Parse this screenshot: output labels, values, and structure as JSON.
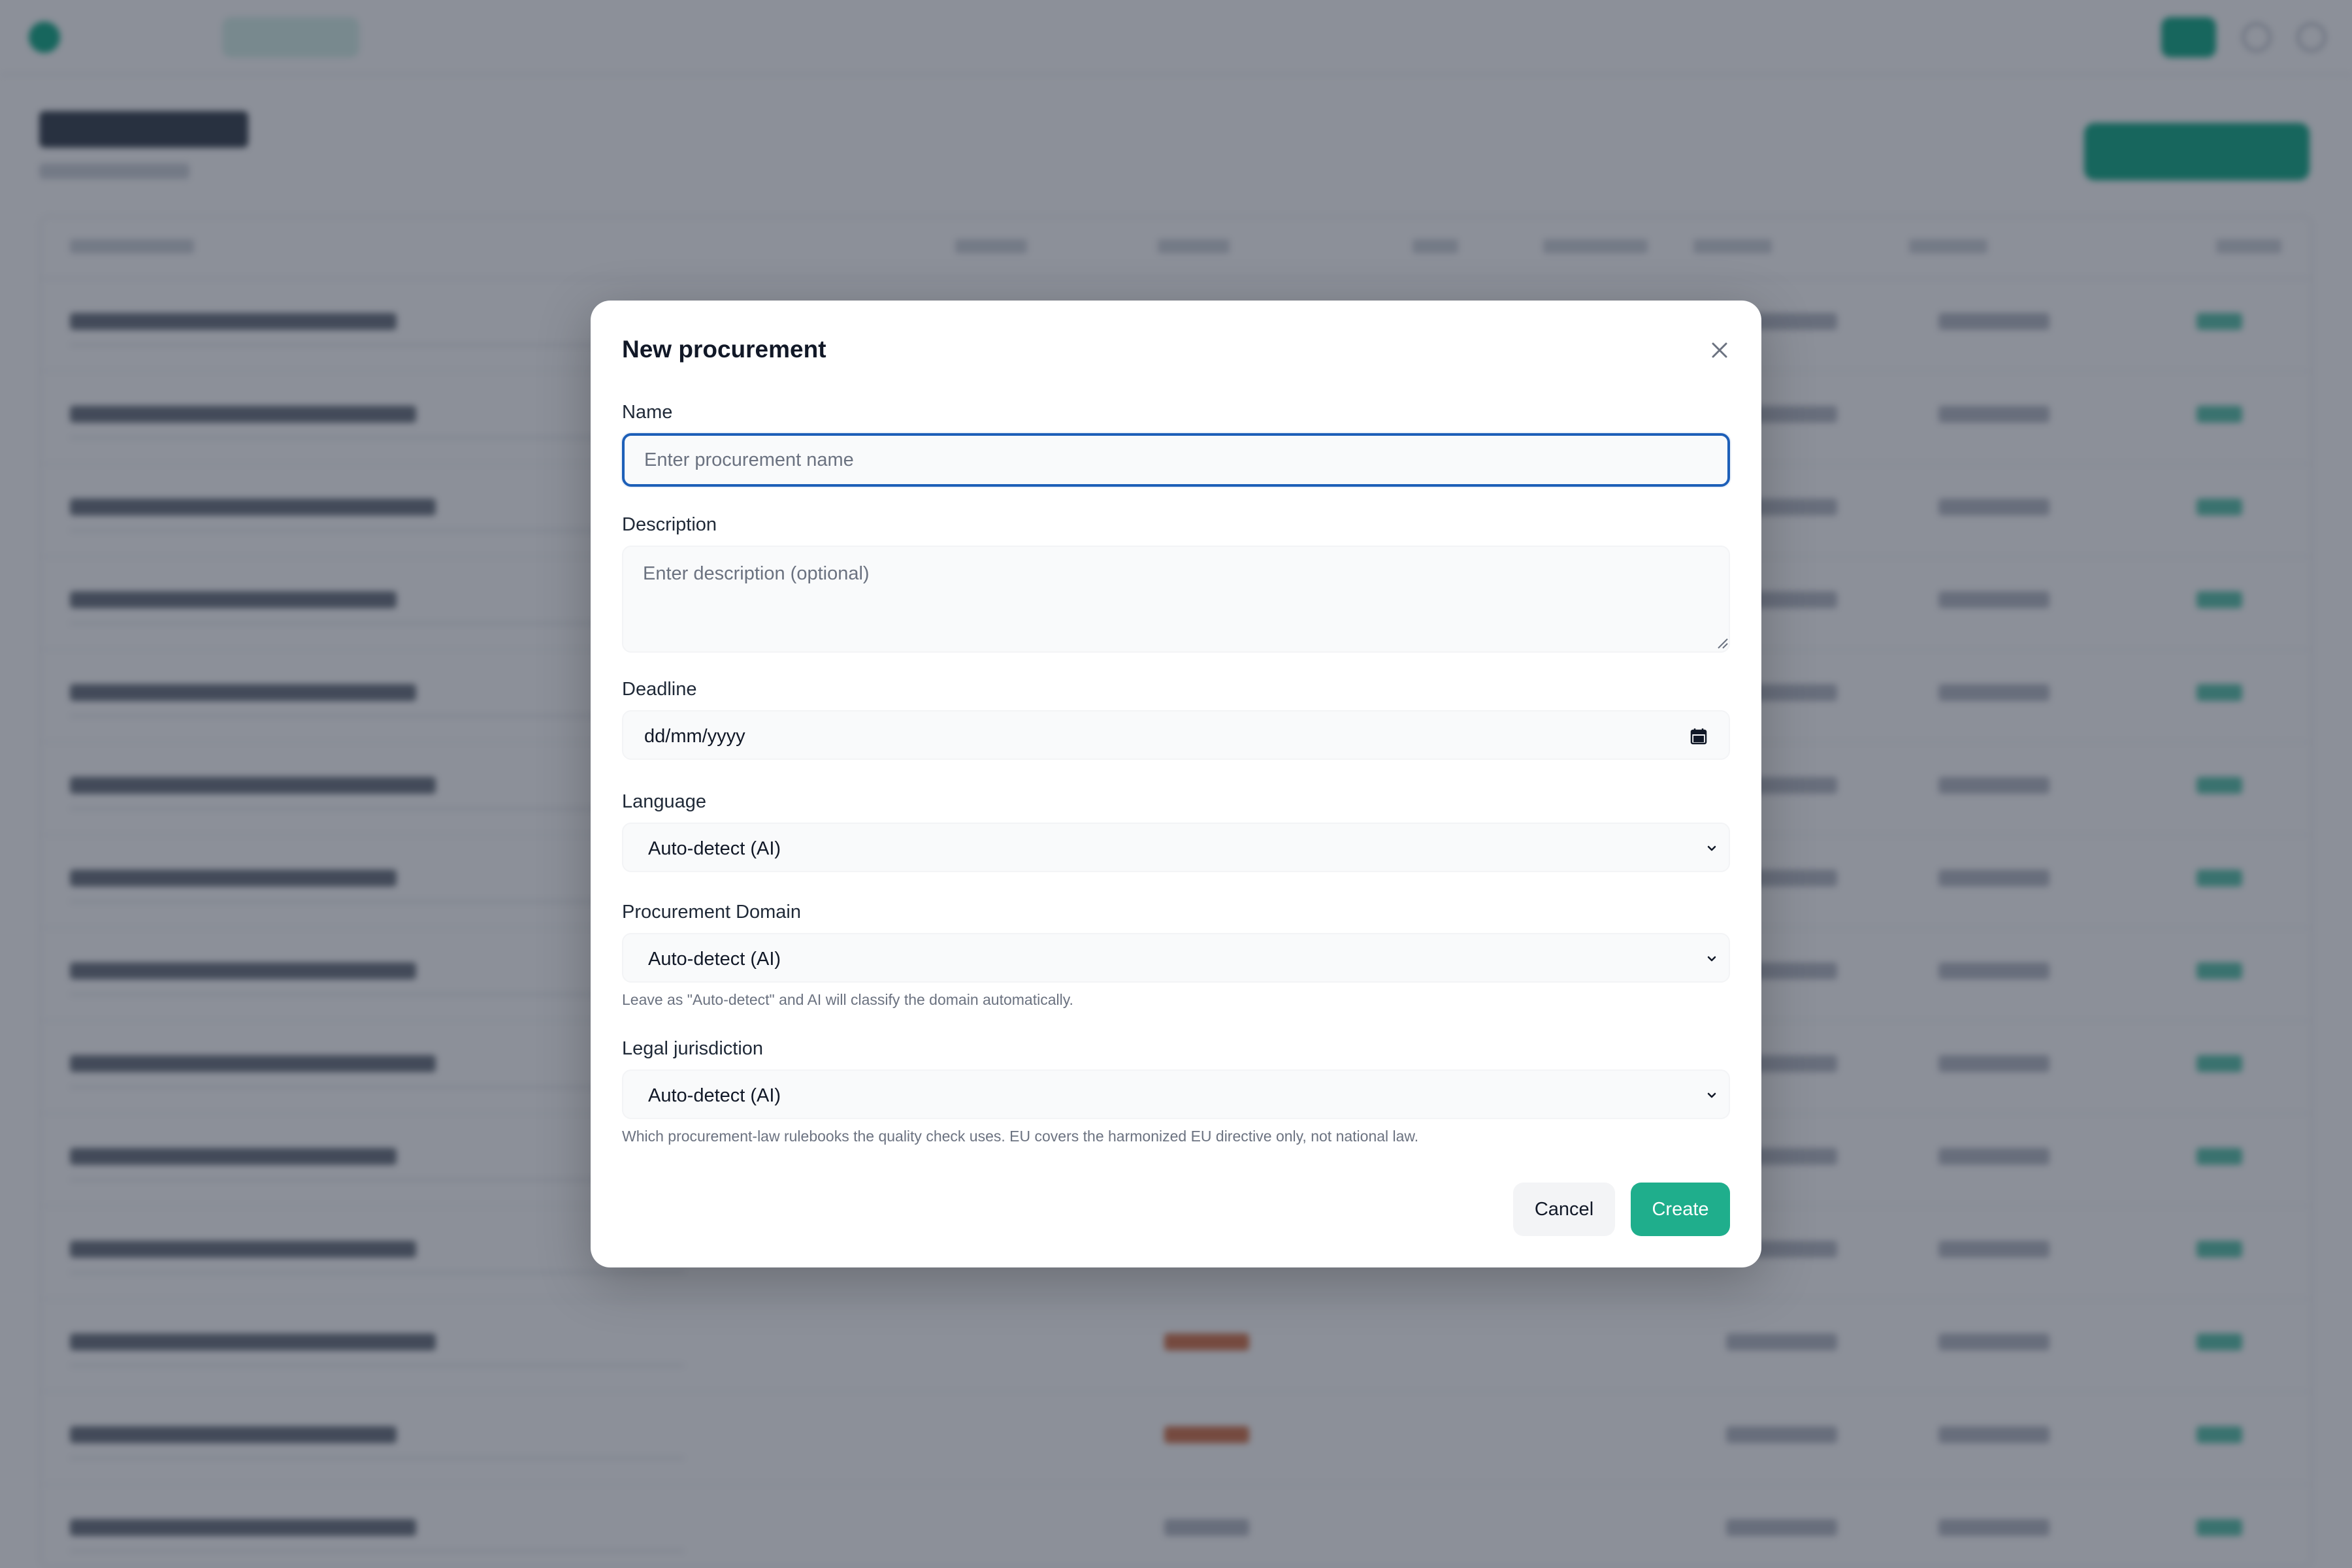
{
  "colors": {
    "accent": "#1fae8c",
    "focus_ring": "#1d5fb8",
    "overlay": "rgba(15,23,42,0.48)"
  },
  "modal": {
    "title": "New procurement",
    "close_icon": "close-icon",
    "name": {
      "label": "Name",
      "value": "",
      "placeholder": "Enter procurement name"
    },
    "description": {
      "label": "Description",
      "value": "",
      "placeholder": "Enter description (optional)"
    },
    "deadline": {
      "label": "Deadline",
      "value": "dd/mm/yyyy",
      "icon": "calendar-icon"
    },
    "language": {
      "label": "Language",
      "value": "Auto-detect (AI)",
      "icon": "chevron-down-icon"
    },
    "domain": {
      "label": "Procurement Domain",
      "value": "Auto-detect (AI)",
      "hint": "Leave as \"Auto-detect\" and AI will classify the domain automatically.",
      "icon": "chevron-down-icon"
    },
    "jurisdiction": {
      "label": "Legal jurisdiction",
      "value": "Auto-detect (AI)",
      "hint": "Which procurement-law rulebooks the quality check uses. EU covers the harmonized EU directive only, not national law.",
      "icon": "chevron-down-icon"
    },
    "cancel_label": "Cancel",
    "create_label": "Create"
  }
}
